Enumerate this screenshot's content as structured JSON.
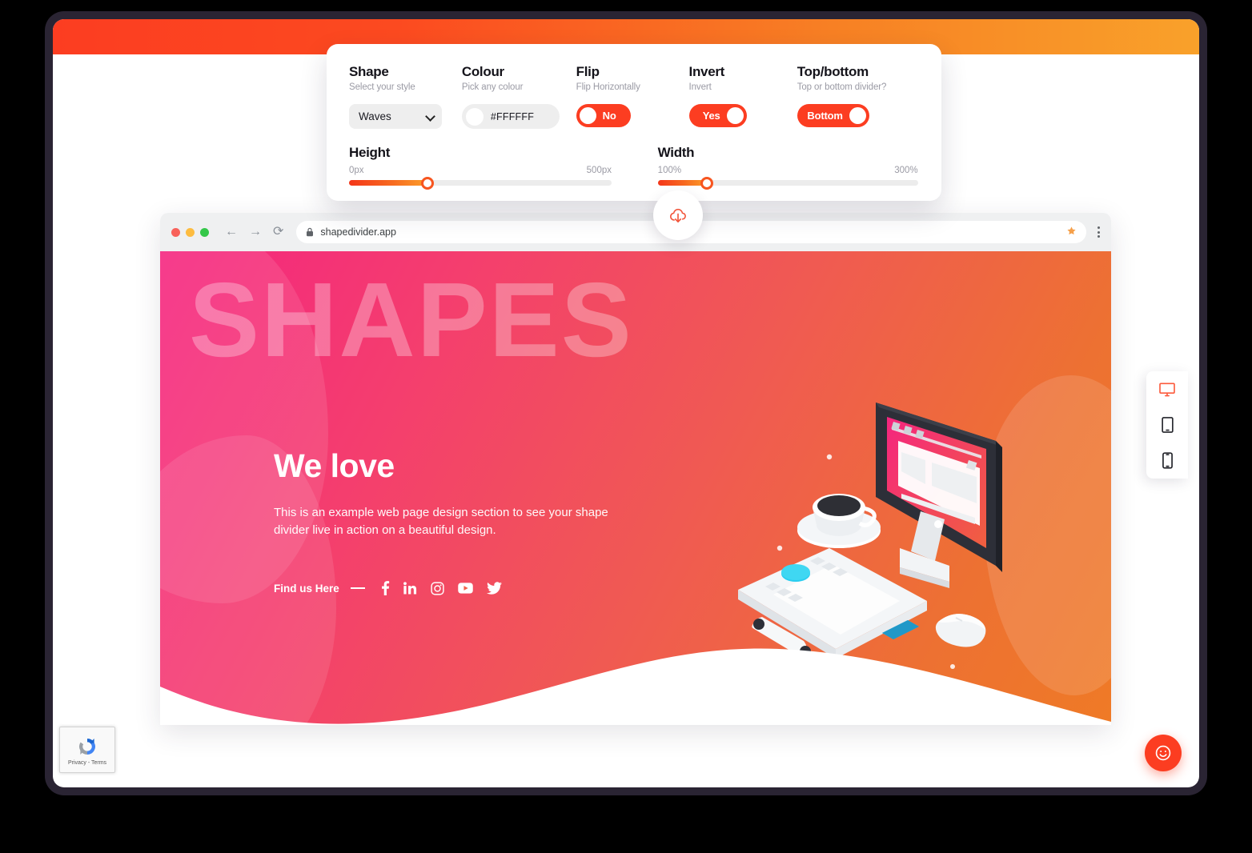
{
  "controls": {
    "shape": {
      "title": "Shape",
      "subtitle": "Select your style",
      "value": "Waves",
      "icon": "chevron-down-icon"
    },
    "colour": {
      "title": "Colour",
      "subtitle": "Pick any colour",
      "value": "#FFFFFF",
      "swatch": "#FFFFFF"
    },
    "flip": {
      "title": "Flip",
      "subtitle": "Flip Horizontally",
      "value": "No",
      "knob_side": "left"
    },
    "invert": {
      "title": "Invert",
      "subtitle": "Invert",
      "value": "Yes",
      "knob_side": "right"
    },
    "topbottom": {
      "title": "Top/bottom",
      "subtitle": "Top or bottom divider?",
      "value": "Bottom",
      "knob_side": "right"
    },
    "height": {
      "title": "Height",
      "min_label": "0px",
      "max_label": "500px",
      "percent": 30
    },
    "width": {
      "title": "Width",
      "min_label": "100%",
      "max_label": "300%",
      "percent": 19
    },
    "download": {
      "icon": "cloud-download-icon"
    }
  },
  "browser": {
    "url": "shapedivider.app",
    "lock_icon": "lock-icon",
    "back_icon": "arrow-left-icon",
    "forward_icon": "arrow-right-icon",
    "reload_icon": "reload-icon",
    "star_icon": "star-icon",
    "menu_icon": "kebab-menu-icon",
    "traffic_lights": [
      "close-red",
      "minimize-yellow",
      "maximize-green"
    ]
  },
  "hero": {
    "watermark": "SHAPES",
    "title": "We love",
    "description": "This is an example web page design section to see your shape divider live in action on a beautiful design.",
    "find_label": "Find us Here",
    "socials": [
      {
        "name": "facebook-icon"
      },
      {
        "name": "linkedin-icon"
      },
      {
        "name": "instagram-icon"
      },
      {
        "name": "youtube-icon"
      },
      {
        "name": "twitter-icon"
      }
    ]
  },
  "device_switcher": {
    "items": [
      {
        "name": "desktop-icon",
        "active": true
      },
      {
        "name": "tablet-icon",
        "active": false
      },
      {
        "name": "mobile-icon",
        "active": false
      }
    ],
    "active_color": "#fc5a3c"
  },
  "recaptcha": {
    "terms": "Privacy - Terms",
    "icon": "recaptcha-icon"
  },
  "chat": {
    "icon": "smiley-icon"
  },
  "colors": {
    "accent": "#fc3d21",
    "topbar_from": "#fc3d21",
    "topbar_to": "#f9a12a",
    "hero_from": "#f5257f",
    "hero_to": "#ef7a26",
    "frame": "#2a2433"
  }
}
